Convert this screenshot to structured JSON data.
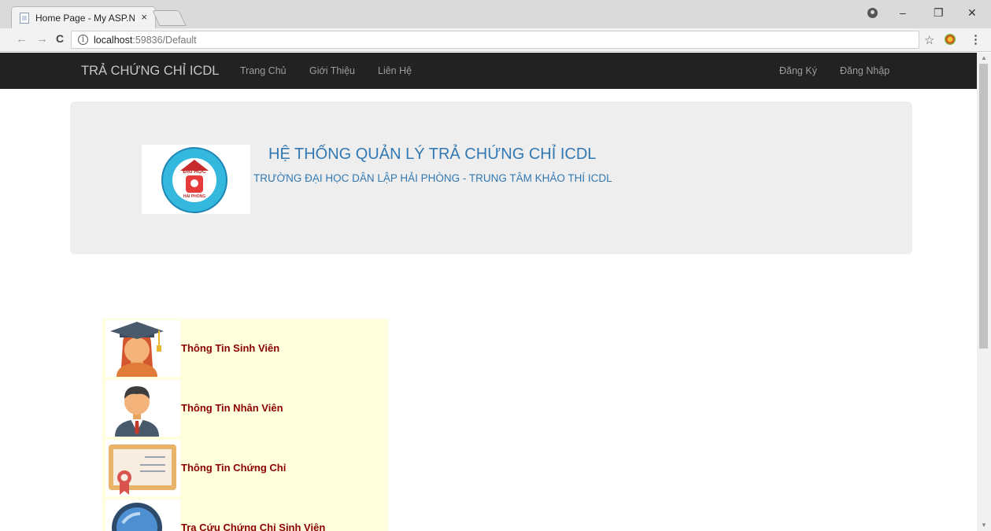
{
  "browser": {
    "tab_title": "Home Page - My ASP.NE",
    "tab_close": "×",
    "url_host": "localhost",
    "url_rest": ":59836/Default",
    "info": "i",
    "controls": {
      "minimize": "–",
      "restore": "❐",
      "close": "✕"
    },
    "nav": {
      "back": "←",
      "forward": "→",
      "reload": "C"
    },
    "star": "☆",
    "menu": "⋮"
  },
  "navbar": {
    "brand": "TRẢ CHỨNG CHỈ ICDL",
    "links": [
      "Trang Chủ",
      "Giới Thiệu",
      "Liên Hệ"
    ],
    "right_links": [
      "Đăng Ký",
      "Đăng Nhập"
    ]
  },
  "jumbotron": {
    "title": "HỆ THỐNG QUẢN LÝ TRẢ CHỨNG CHỈ ICDL",
    "subtitle": "TRƯỜNG ĐẠI HỌC DÂN LẬP HẢI PHÒNG - TRUNG TÂM KHẢO THÍ ICDL",
    "logo_text_top": "ĐẠI HỌC",
    "logo_text_bottom": "HẢI PHÒNG"
  },
  "menu": {
    "items": [
      {
        "label": "Thông Tin Sinh Viên",
        "icon": "graduate-student-icon"
      },
      {
        "label": "Thông Tin Nhân Viên",
        "icon": "employee-icon"
      },
      {
        "label": "Thông Tin Chứng Chỉ",
        "icon": "certificate-icon"
      },
      {
        "label": "Tra Cứu Chứng Chỉ Sinh Viên",
        "icon": "search-lookup-icon"
      }
    ]
  },
  "colors": {
    "navbar_bg": "#222222",
    "jumbotron_bg": "#eeeeee",
    "title_blue": "#3278b3",
    "menu_panel_bg": "#ffffdd",
    "menu_label": "#8b0000"
  }
}
